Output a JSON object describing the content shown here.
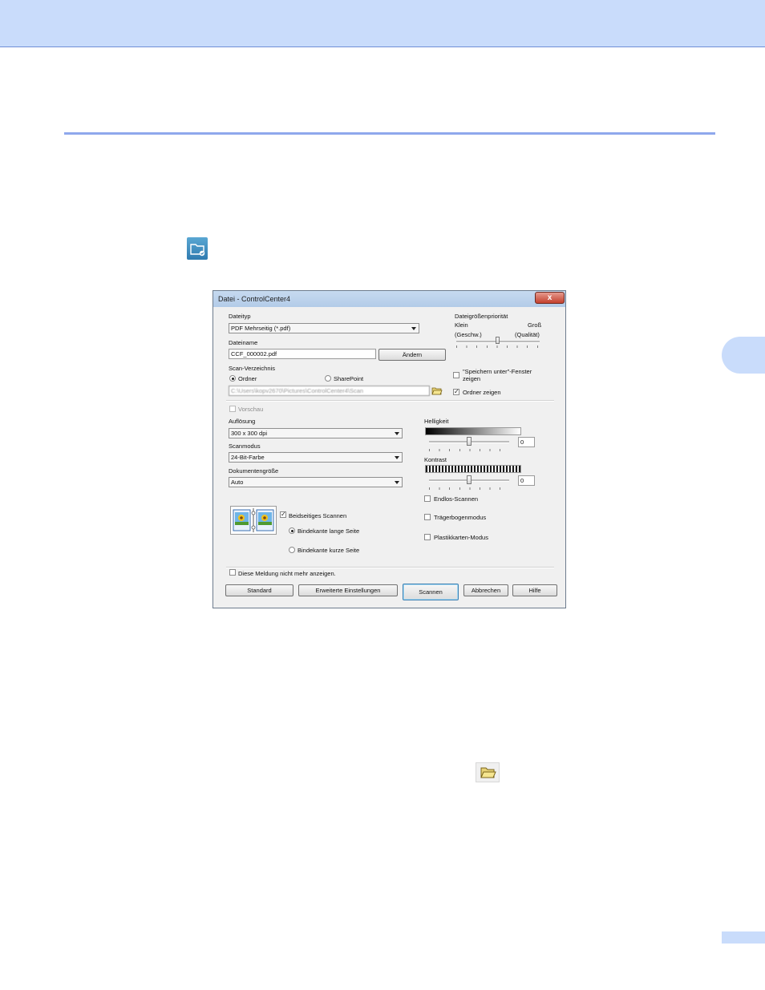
{
  "dialog": {
    "title": "Datei - ControlCenter4",
    "close_glyph": "x",
    "file_type": {
      "label": "Dateityp",
      "value": "PDF Mehrseitig (*.pdf)"
    },
    "file_name": {
      "label": "Dateiname",
      "value": "CCF_000002.pdf",
      "change_button": "Ändern"
    },
    "scan_folder": {
      "label": "Scan-Verzeichnis",
      "option_folder": "Ordner",
      "option_sharepoint": "SharePoint",
      "path": "C:\\Users\\kopv2670\\Pictures\\ControlCenter4\\Scan"
    },
    "size_priority": {
      "label": "Dateigrößenpriorität",
      "small": "Klein",
      "small_note": "(Geschw.)",
      "large": "Groß",
      "large_note": "(Qualität)",
      "level": 0.5
    },
    "save_as_window": "\"Speichern unter\"-Fenster zeigen",
    "show_folder": "Ordner zeigen",
    "preview": "Vorschau",
    "resolution": {
      "label": "Auflösung",
      "value": "300 x 300 dpi"
    },
    "scan_mode": {
      "label": "Scanmodus",
      "value": "24-Bit-Farbe"
    },
    "document_size": {
      "label": "Dokumentengröße",
      "value": "Auto"
    },
    "brightness": {
      "label": "Helligkeit",
      "value": "0",
      "level": 0.5
    },
    "contrast": {
      "label": "Kontrast",
      "value": "0",
      "level": 0.5
    },
    "duplex": {
      "label": "Beidseitiges Scannen",
      "long_edge": "Bindekante lange Seite",
      "short_edge": "Bindekante kurze Seite"
    },
    "continuous_scan": "Endlos-Scannen",
    "carrier_sheet": "Trägerbogenmodus",
    "plastic_card": "Plastikkarten-Modus",
    "dont_show": "Diese Meldung nicht mehr anzeigen.",
    "buttons": {
      "default": "Standard",
      "advanced": "Erweiterte Einstellungen",
      "scan": "Scannen",
      "cancel": "Abbrechen",
      "help": "Hilfe"
    },
    "check_mark": "✓"
  },
  "colors": {
    "header_band": "#c9dcfb",
    "rule": "#8fa8ec"
  },
  "icons": {
    "app_icon": "folder-scan-icon",
    "folder_button_icon": "folder-open-icon"
  }
}
